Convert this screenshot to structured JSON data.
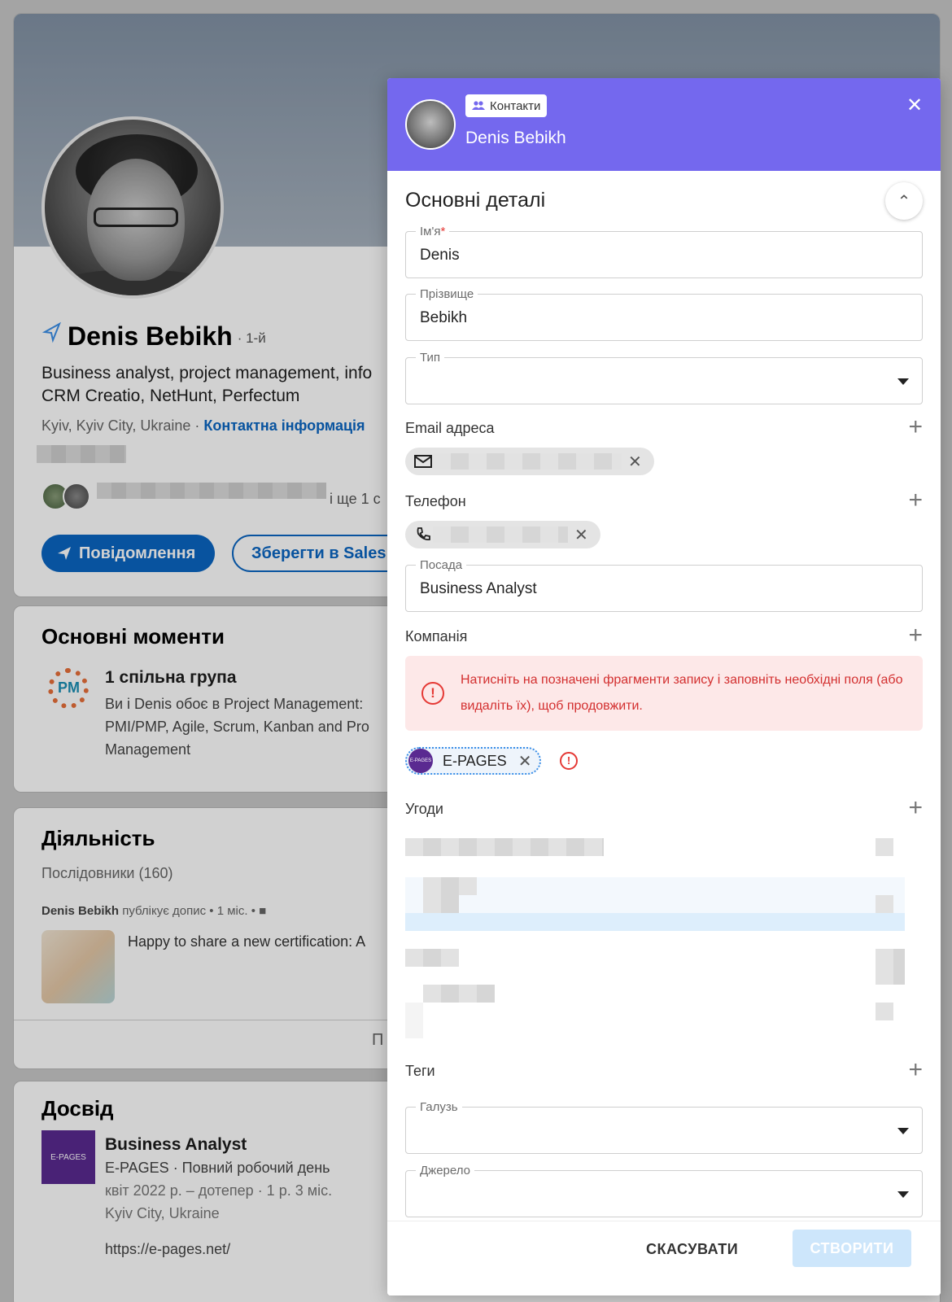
{
  "profile": {
    "name": "Denis Bebikh",
    "degree": "· 1-й",
    "headline_1": "Business analyst, project management, info",
    "headline_2": "CRM Creatio, NetHunt, Perfectum",
    "location": "Kyiv, Kyiv City, Ukraine · ",
    "contact_link": "Контактна інформація",
    "mutual_tail": "і ще 1 с",
    "message_button": "Повідомлення",
    "save_button": "Зберегти в Sales"
  },
  "highlights": {
    "title": "Основні моменти",
    "group_title": "1 спільна група",
    "group_text": "Ви і Denis обоє в Project Management: PMI/PMP, Agile, Scrum, Kanban and Pro Management",
    "logo_text": "PM"
  },
  "activity": {
    "title": "Діяльність",
    "followers": "Послідовники (160)",
    "post_author": "Denis Bebikh",
    "post_meta": " публікує допис • 1 міс. •",
    "post_text": "Happy to share a new certification: A",
    "show_all": "П"
  },
  "experience": {
    "title": "Досвід",
    "job_title": "Business Analyst",
    "company_line": "E-PAGES · Повний робочий день",
    "dates": "квіт 2022 р. – дотепер · 1 р. 3 міс.",
    "place": "Kyiv City, Ukraine",
    "url": "https://e-pages.net/",
    "logo_text": "E-PAGES"
  },
  "modal": {
    "badge": "Контакти",
    "name": "Denis Bebikh",
    "section_title": "Основні деталі",
    "first_name_label": "Ім'я",
    "first_name_required": "*",
    "first_name_value": "Denis",
    "last_name_label": "Прізвище",
    "last_name_value": "Bebikh",
    "type_label": "Тип",
    "type_value": "",
    "email_label": "Email адреса",
    "phone_label": "Телефон",
    "position_label": "Посада",
    "position_value": "Business Analyst",
    "company_label": "Компанія",
    "alert_text": "Натисніть на позначені фрагменти запису і заповніть необхідні поля (або видаліть їх), щоб продовжити.",
    "company_chip": "E-PAGES",
    "company_logo_text": "E-PAGES",
    "deals_label": "Угоди",
    "tags_label": "Теги",
    "industry_label": "Галузь",
    "source_label": "Джерело",
    "cancel_button": "СКАСУВАТИ",
    "create_button": "СТВОРИТИ"
  },
  "colors": {
    "header": "#7468ee",
    "linkedin_blue": "#0a66c2",
    "error": "#d32f2f",
    "create_disabled": "#cde6fb"
  },
  "icons": [
    "sales-navigator-icon",
    "send-icon",
    "contacts-icon",
    "close-icon",
    "chevron-up-icon",
    "plus-icon",
    "mail-icon",
    "phone-icon",
    "error-icon",
    "caret-down-icon"
  ]
}
